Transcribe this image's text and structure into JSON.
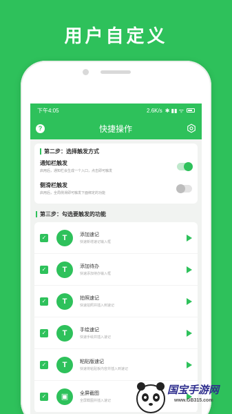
{
  "hero": {
    "title": "用户自定义"
  },
  "status": {
    "time": "下午4:05",
    "speed": "2.6K/s",
    "icons": "✱ ▮▮ ᯤ"
  },
  "appbar": {
    "title": "快捷操作",
    "help_label": "?"
  },
  "step2": {
    "title": "第二步：选择触发方式",
    "options": [
      {
        "title": "通知栏触发",
        "desc": "启用后，通知栏会生成一个入口，点击即可触发",
        "on": true
      },
      {
        "title": "侧滑栏触发",
        "desc": "启用后，全局侧滑即可触发下面绑定的功能",
        "on": false
      }
    ]
  },
  "step3": {
    "title": "第三步：勾选要触发的功能",
    "items": [
      {
        "title": "添加速记",
        "desc": "快速新增速记输入框"
      },
      {
        "title": "添加待办",
        "desc": "快速添加待办输入框"
      },
      {
        "title": "拍照速记",
        "desc": "快速拍照并插入到速记"
      },
      {
        "title": "手绘速记",
        "desc": "快速手绘并插入速记"
      },
      {
        "title": "粘贴版速记",
        "desc": "快速将粘贴板内容并插入到速记"
      },
      {
        "title": "全屏截图",
        "desc": "全屏截图并插入速记"
      }
    ]
  },
  "watermark": {
    "brand": "国宝手游网",
    "url": "www.GB315.com"
  },
  "colors": {
    "accent": "#2ec15b",
    "background": "#f1f3f1"
  }
}
